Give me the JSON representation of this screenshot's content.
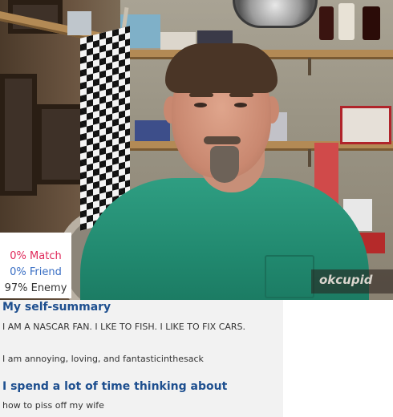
{
  "match_stats": {
    "match": "0% Match",
    "friend": "0% Friend",
    "enemy": "97% Enemy"
  },
  "watermark": "okcupid",
  "profile": {
    "self_summary_heading": "My self-summary",
    "self_summary_line1": "I AM A NASCAR FAN. I LKE TO FISH. I LIKE TO FIX CARS.",
    "self_summary_line2": "I am annoying, loving, and fantasticinthesack",
    "thinking_heading": "I spend a lot of time thinking about",
    "thinking_text": "how to piss off my wife"
  },
  "colors": {
    "match": "#e0285a",
    "friend": "#3a6fc4",
    "heading": "#1e4f8f"
  }
}
